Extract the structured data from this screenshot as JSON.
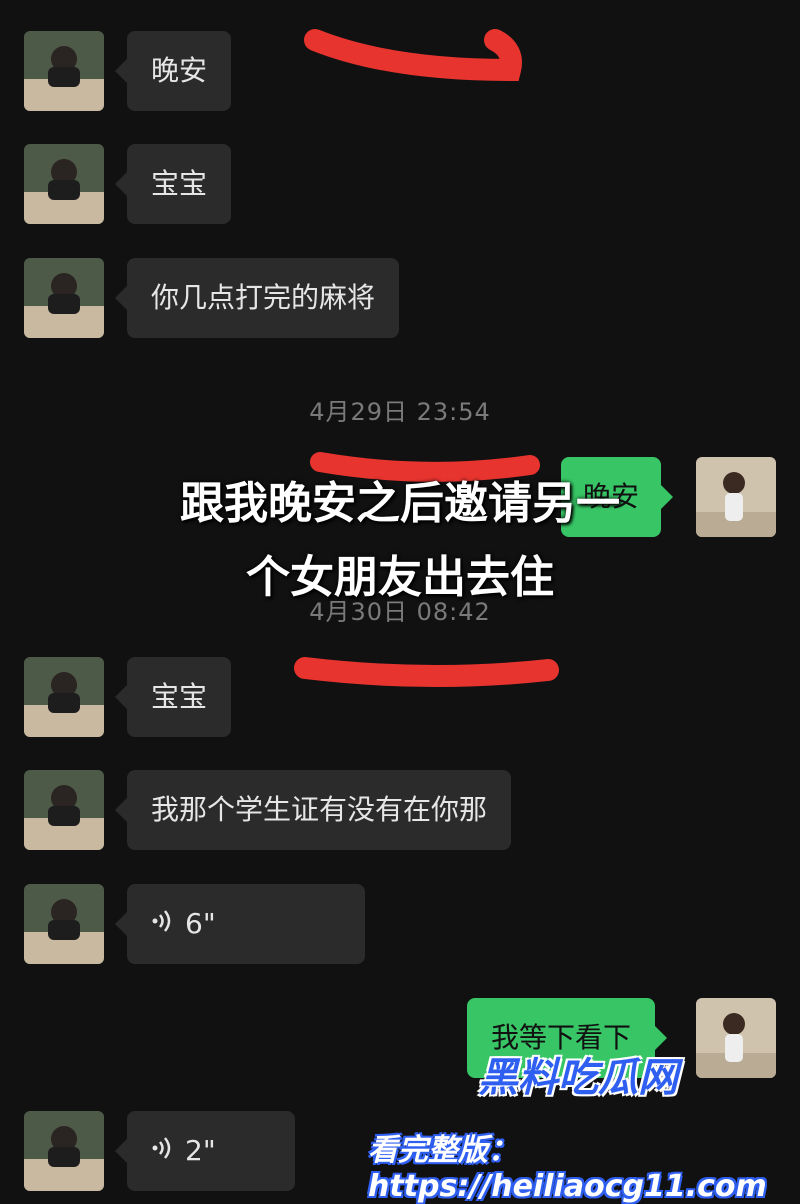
{
  "messages": {
    "m1": "晚安",
    "m2": "宝宝",
    "m3": "你几点打完的麻将",
    "m4": "晚安",
    "m5": "宝宝",
    "m6": "我那个学生证有没有在你那",
    "m7_duration": "6\"",
    "m8": "我等下看下",
    "m9_duration": "2\""
  },
  "timestamps": {
    "t1": "4月29日 23:54",
    "t2": "4月30日 08:42"
  },
  "overlay": {
    "line1": "跟我晚安之后邀请另一",
    "line2": "个女朋友出去住"
  },
  "watermark": {
    "brand": "黑料吃瓜网",
    "url": "看完整版：https://heiliaocg11.com"
  },
  "colors": {
    "background": "#111111",
    "bubble_left": "#2b2b2b",
    "bubble_right": "#38c565",
    "annotation_red": "#e8342f",
    "watermark_blue": "#2f5ff0"
  },
  "icons": {
    "voice": "voice-wave-icon",
    "contact_avatar": "avatar-man",
    "self_avatar": "avatar-girl"
  }
}
